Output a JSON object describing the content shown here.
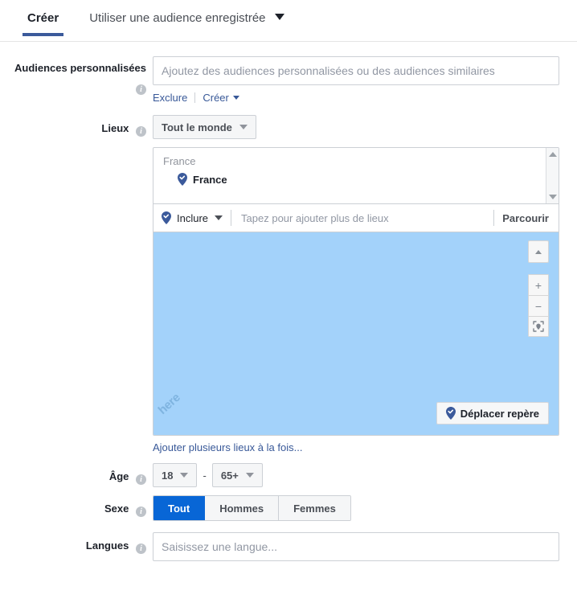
{
  "tabs": [
    {
      "label": "Créer",
      "active": true
    },
    {
      "label": "Utiliser une audience enregistrée",
      "active": false,
      "has_caret": true
    }
  ],
  "custom_audiences": {
    "label": "Audiences personnalisées",
    "placeholder": "Ajoutez des audiences personnalisées ou des audiences similaires",
    "value": "",
    "links": {
      "exclude": "Exclure",
      "create": "Créer"
    }
  },
  "locations": {
    "label": "Lieux",
    "scope_button": "Tout le monde",
    "group_title": "France",
    "selected": [
      {
        "name": "France",
        "icon": "map-pin-check-icon"
      }
    ],
    "include_mode": "Inclure",
    "typeahead_placeholder": "Tapez pour ajouter plus de lieux",
    "typeahead_value": "",
    "browse_button": "Parcourir",
    "map": {
      "watermark": "here",
      "move_pin_button": "Déplacer repère",
      "controls": {
        "collapse": "chevron-up-icon",
        "zoom_in": "+",
        "zoom_out": "−",
        "recenter": "locate-icon"
      }
    },
    "bulk_link": "Ajouter plusieurs lieux à la fois..."
  },
  "age": {
    "label": "Âge",
    "min": "18",
    "max": "65+",
    "separator": "-"
  },
  "gender": {
    "label": "Sexe",
    "options": [
      {
        "label": "Tout",
        "active": true
      },
      {
        "label": "Hommes",
        "active": false
      },
      {
        "label": "Femmes",
        "active": false
      }
    ]
  },
  "languages": {
    "label": "Langues",
    "placeholder": "Saisissez une langue...",
    "value": ""
  },
  "icons": {
    "info": "i"
  },
  "colors": {
    "accent_blue": "#0866d6",
    "tab_underline": "#3b5a9b",
    "link_blue": "#385898",
    "map_blue": "#a3d2fa",
    "pin_blue": "#3b5a9b",
    "border_gray": "#ccd0d5"
  }
}
